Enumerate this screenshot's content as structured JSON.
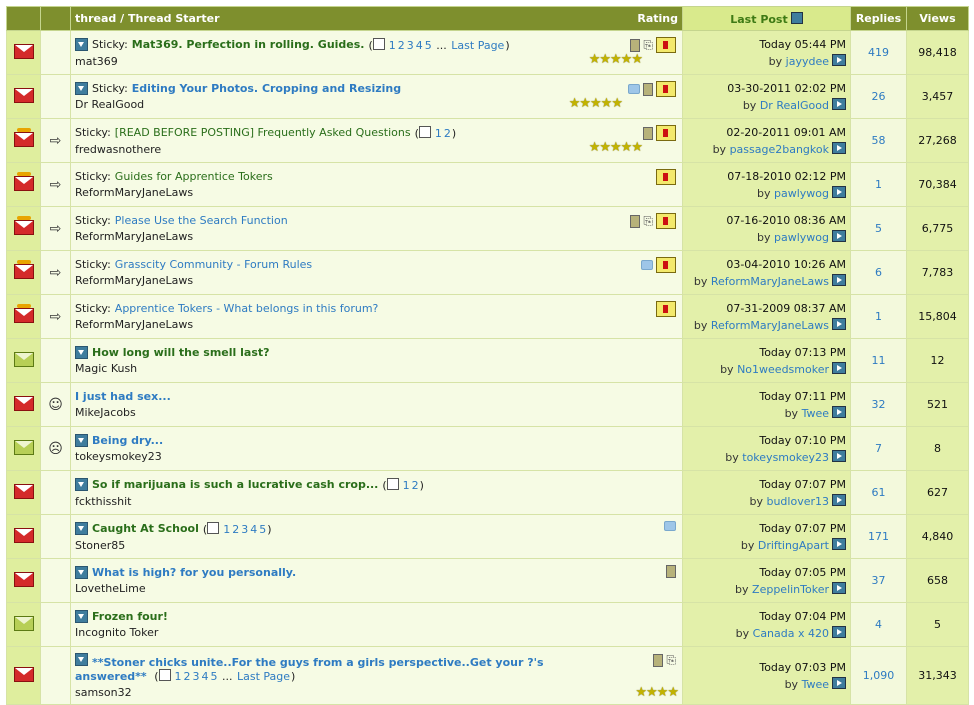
{
  "header": {
    "thread_label": "thread",
    "starter_label": "Thread Starter",
    "rating_label": "Rating",
    "lastpost_label": "Last Post",
    "replies_label": "Replies",
    "views_label": "Views"
  },
  "threads": [
    {
      "prefix": "Sticky:",
      "title": "Mat369. Perfection in rolling. Guides.",
      "pages": [
        "1",
        "2",
        "3",
        "4",
        "5"
      ],
      "pages_more": "...",
      "last_page": "Last Page",
      "starter": "mat369",
      "date": "Today",
      "time": "05:44 PM",
      "by": "by",
      "user": "jayydee",
      "replies": "419",
      "views": "98,418",
      "stars": "★★★★★"
    },
    {
      "prefix": "Sticky:",
      "title": "Editing Your Photos. Cropping and Resizing",
      "starter": "Dr RealGood",
      "date": "03-30-2011",
      "time": "02:02 PM",
      "by": "by",
      "user": "Dr RealGood",
      "replies": "26",
      "views": "3,457",
      "stars": "★★★★★"
    },
    {
      "prefix": "Sticky:",
      "title": "[READ BEFORE POSTING] Frequently Asked Questions",
      "pages": [
        "1",
        "2"
      ],
      "starter": "fredwasnothere",
      "date": "02-20-2011",
      "time": "09:01 AM",
      "by": "by",
      "user": "passage2bangkok",
      "replies": "58",
      "views": "27,268",
      "stars": "★★★★★"
    },
    {
      "prefix": "Sticky:",
      "title": "Guides for Apprentice Tokers",
      "starter": "ReformMaryJaneLaws",
      "date": "07-18-2010",
      "time": "02:12 PM",
      "by": "by",
      "user": "pawlywog",
      "replies": "1",
      "views": "70,384"
    },
    {
      "prefix": "Sticky:",
      "title": "Please Use the Search Function",
      "starter": "ReformMaryJaneLaws",
      "date": "07-16-2010",
      "time": "08:36 AM",
      "by": "by",
      "user": "pawlywog",
      "replies": "5",
      "views": "6,775"
    },
    {
      "prefix": "Sticky:",
      "title": "Grasscity Community - Forum Rules",
      "starter": "ReformMaryJaneLaws",
      "date": "03-04-2010",
      "time": "10:26 AM",
      "by": "by",
      "user": "ReformMaryJaneLaws",
      "replies": "6",
      "views": "7,783"
    },
    {
      "prefix": "Sticky:",
      "title": "Apprentice Tokers - What belongs in this forum?",
      "starter": "ReformMaryJaneLaws",
      "date": "07-31-2009",
      "time": "08:37 AM",
      "by": "by",
      "user": "ReformMaryJaneLaws",
      "replies": "1",
      "views": "15,804"
    },
    {
      "title": "How long will the smell last?",
      "starter": "Magic Kush",
      "date": "Today",
      "time": "07:13 PM",
      "by": "by",
      "user": "No1weedsmoker",
      "replies": "11",
      "views": "12"
    },
    {
      "title": "I just had sex...",
      "starter": "MikeJacobs",
      "date": "Today",
      "time": "07:11 PM",
      "by": "by",
      "user": "Twee",
      "replies": "32",
      "views": "521"
    },
    {
      "title": "Being dry...",
      "starter": "tokeysmokey23",
      "date": "Today",
      "time": "07:10 PM",
      "by": "by",
      "user": "tokeysmokey23",
      "replies": "7",
      "views": "8"
    },
    {
      "title": "So if marijuana is such a lucrative cash crop...",
      "pages": [
        "1",
        "2"
      ],
      "starter": "fckthisshit",
      "date": "Today",
      "time": "07:07 PM",
      "by": "by",
      "user": "budlover13",
      "replies": "61",
      "views": "627"
    },
    {
      "title": "Caught At School",
      "pages": [
        "1",
        "2",
        "3",
        "4",
        "5"
      ],
      "starter": "Stoner85",
      "date": "Today",
      "time": "07:07 PM",
      "by": "by",
      "user": "DriftingApart",
      "replies": "171",
      "views": "4,840"
    },
    {
      "title": "What is high? for you personally.",
      "starter": "LovetheLime",
      "date": "Today",
      "time": "07:05 PM",
      "by": "by",
      "user": "ZeppelinToker",
      "replies": "37",
      "views": "658"
    },
    {
      "title": "Frozen four!",
      "starter": "Incognito Toker",
      "date": "Today",
      "time": "07:04 PM",
      "by": "by",
      "user": "Canada x 420",
      "replies": "4",
      "views": "5"
    },
    {
      "title": "**Stoner chicks unite..For the guys from a girls perspective..Get your ?'s answered**",
      "pages": [
        "1",
        "2",
        "3",
        "4",
        "5"
      ],
      "pages_more": "...",
      "last_page": "Last Page",
      "starter": "samson32",
      "date": "Today",
      "time": "07:03 PM",
      "by": "by",
      "user": "Twee",
      "replies": "1,090",
      "views": "31,343",
      "stars": "★★★★"
    }
  ]
}
